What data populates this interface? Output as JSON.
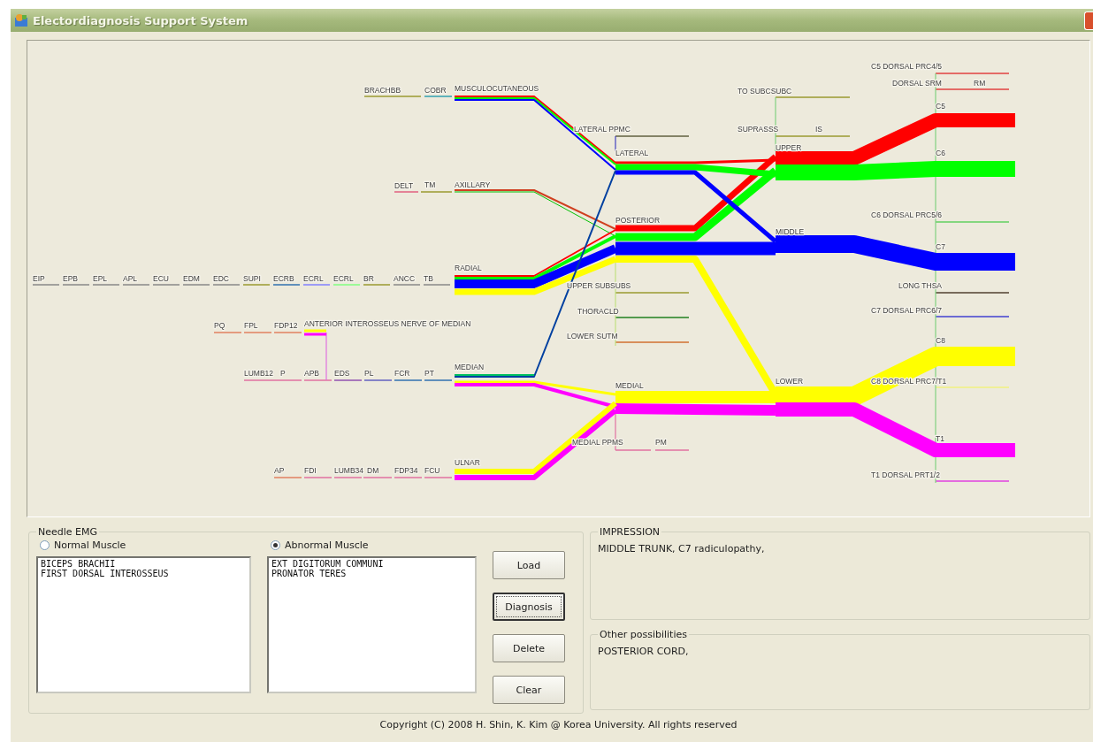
{
  "window": {
    "title": "Electordiagnosis Support System"
  },
  "diagram": {
    "labels": [
      "BRACHBB",
      "COBR",
      "MUSCULOCUTANEOUS",
      "LATERAL PPMC",
      "TO SUBCSUBC",
      "SUPRASSS",
      "IS",
      "UPPER",
      "LATERAL",
      "C5 DORSAL PRC4/5",
      "DORSAL SRM",
      "RM",
      "C5",
      "C6",
      "DELT",
      "TM",
      "AXILLARY",
      "POSTERIOR",
      "MIDDLE",
      "C6 DORSAL PRC5/6",
      "C7",
      "RADIAL",
      "EIP",
      "EPB",
      "EPL",
      "APL",
      "ECU",
      "EDM",
      "EDC",
      "SUPI",
      "ECRB",
      "ECRL",
      "ECRL",
      "BR",
      "ANCC",
      "TB",
      "UPPER SUBSUBS",
      "LONG THSA",
      "THORACLD",
      "C7 DORSAL PRC6/7",
      "PQ",
      "FPL",
      "FDP12",
      "ANTERIOR INTEROSSEUS NERVE OF MEDIAN",
      "LOWER SUTM",
      "C8",
      "MEDIAN",
      "LUMB12",
      "P",
      "APB",
      "EDS",
      "PL",
      "FCR",
      "PT",
      "LOWER",
      "C8 DORSAL PRC7/T1",
      "MEDIAL",
      "MEDIAL PPMS",
      "PM",
      "T1",
      "ULNAR",
      "AP",
      "FDI",
      "LUMB34",
      "DM",
      "FDP34",
      "FCU",
      "T1 DORSAL PRT1/2"
    ]
  },
  "needle_emg": {
    "title": "Needle EMG",
    "options": [
      {
        "label": "Normal Muscle",
        "selected": false
      },
      {
        "label": "Abnormal Muscle",
        "selected": true
      }
    ],
    "lists": [
      [
        "BICEPS BRACHII",
        "FIRST DORSAL INTEROSSEUS"
      ],
      [
        "EXT DIGITORUM COMMUNI",
        "PRONATOR TERES"
      ]
    ]
  },
  "buttons": [
    {
      "label": "Load",
      "focused": false
    },
    {
      "label": "Diagnosis",
      "focused": true
    },
    {
      "label": "Delete",
      "focused": false
    },
    {
      "label": "Clear",
      "focused": false
    }
  ],
  "impression": {
    "title": "IMPRESSION",
    "text": "MIDDLE TRUNK, C7 radiculopathy,"
  },
  "other_possibilities": {
    "title": "Other possibilities",
    "text": "POSTERIOR CORD,"
  },
  "copyright": "Copyright (C) 2008 H. Shin, K. Kim @ Korea University. All rights reserved"
}
